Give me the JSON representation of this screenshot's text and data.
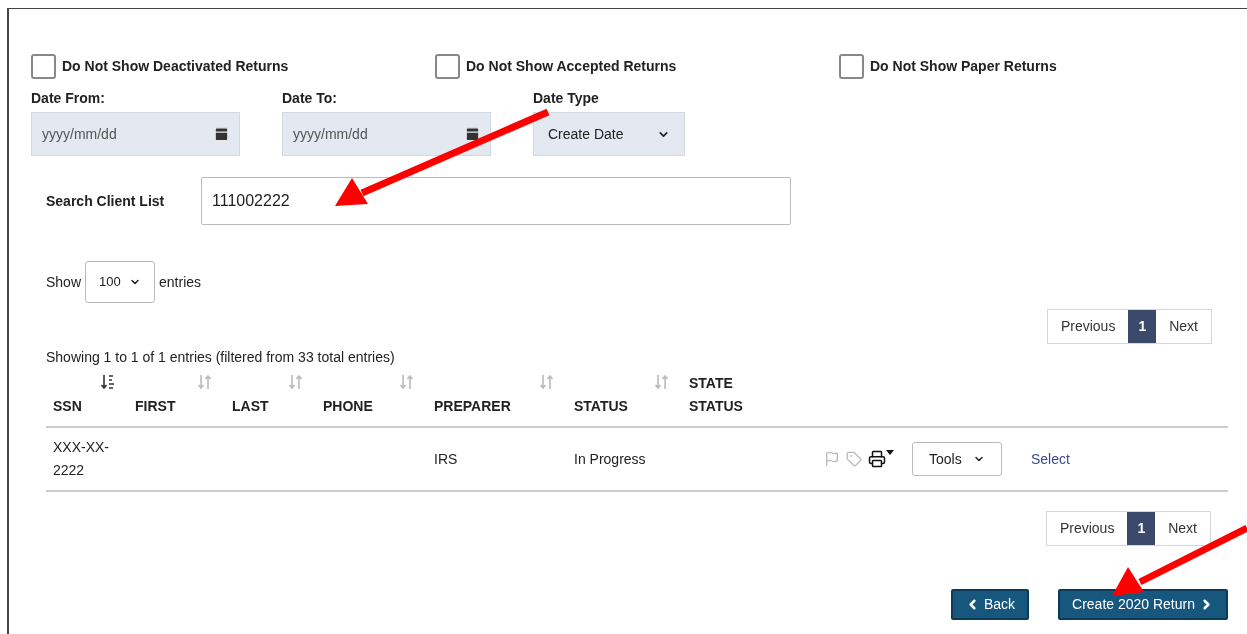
{
  "filters": [
    {
      "label": "Do Not Show Deactivated Returns",
      "checked": false
    },
    {
      "label": "Do Not Show Accepted Returns",
      "checked": false
    },
    {
      "label": "Do Not Show Paper Returns",
      "checked": false
    }
  ],
  "date_from": {
    "label": "Date From:",
    "placeholder": "yyyy/mm/dd"
  },
  "date_to": {
    "label": "Date To:",
    "placeholder": "yyyy/mm/dd"
  },
  "date_type": {
    "label": "Date Type",
    "value": "Create Date"
  },
  "search": {
    "label": "Search Client List",
    "value": "111002222"
  },
  "length": {
    "before": "Show",
    "value": "100",
    "after": "entries"
  },
  "pagination": {
    "previous": "Previous",
    "page": "1",
    "next": "Next"
  },
  "info": "Showing 1 to 1 of 1 entries (filtered from 33 total entries)",
  "table": {
    "columns": [
      {
        "label": "SSN",
        "kind": "sorted"
      },
      {
        "label": "FIRST",
        "kind": "sortable"
      },
      {
        "label": "LAST",
        "kind": "sortable"
      },
      {
        "label": "PHONE",
        "kind": "sortable"
      },
      {
        "label": "PREPARER",
        "kind": "sortable"
      },
      {
        "label": "STATUS",
        "kind": "sortable"
      },
      {
        "label": "STATE STATUS",
        "kind": "plain"
      }
    ],
    "rows": [
      {
        "cells": [
          "XXX-XX-2222",
          "",
          "",
          "",
          "IRS",
          "In Progress",
          ""
        ],
        "tools": "Tools",
        "link": "Select"
      }
    ]
  },
  "pagination_bottom": {
    "previous": "Previous",
    "page": "1",
    "next": "Next"
  },
  "buttons": {
    "back": "Back",
    "create": "Create 2020 Return"
  }
}
